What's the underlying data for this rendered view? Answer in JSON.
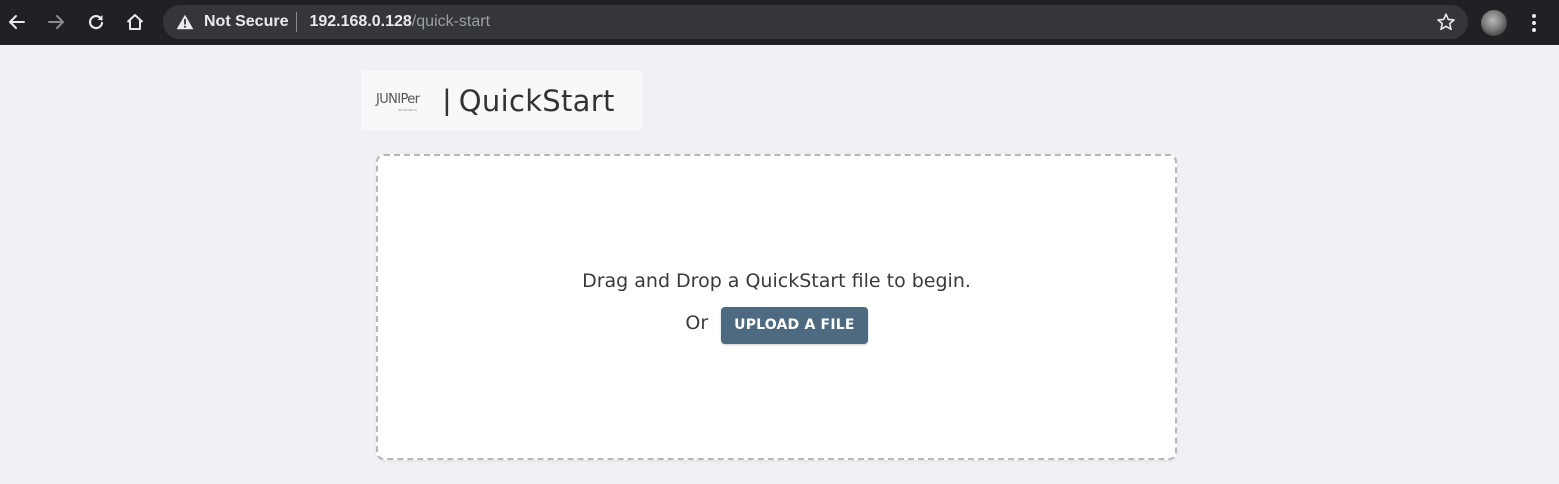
{
  "browser": {
    "security_label": "Not Secure",
    "url_host": "192.168.0.128",
    "url_path": "/quick-start",
    "icons": {
      "back": "back-arrow-icon",
      "forward": "forward-arrow-icon",
      "reload": "reload-icon",
      "home": "home-icon",
      "warning": "warning-triangle-icon",
      "bookmark": "star-icon",
      "profile": "avatar",
      "menu": "kebab-menu-icon"
    }
  },
  "header": {
    "logo_text": "JUNIPer",
    "logo_subtext": "NETWORKS",
    "separator": "|",
    "title": "QuickStart"
  },
  "dropzone": {
    "prompt": "Drag and Drop a QuickStart file to begin.",
    "or_label": "Or",
    "upload_button_label": "UPLOAD A FILE"
  },
  "colors": {
    "browser_bar": "#202124",
    "omnibox": "#35363a",
    "page_background": "#f0f1f4",
    "button_primary": "#4e6a80"
  }
}
